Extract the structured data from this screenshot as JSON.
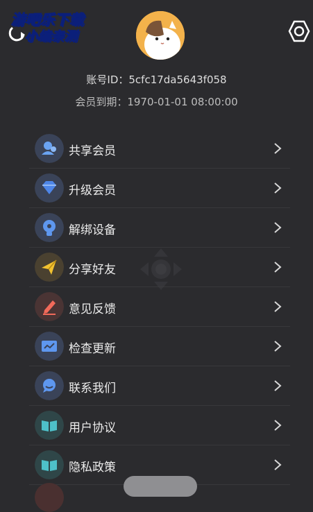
{
  "watermark": {
    "line1": "游吧乐下载",
    "line2": "小编亲测"
  },
  "profile": {
    "account_id": "账号ID：5cfc17da5643f058",
    "member_expiry": "会员到期：1970-01-01 08:00:00"
  },
  "menu": {
    "items": [
      {
        "label": "共享会员",
        "icon": "share-member-icon",
        "icon_bg": "#3a4358",
        "icon_color": "#6aa3f2"
      },
      {
        "label": "升级会员",
        "icon": "diamond-icon",
        "icon_bg": "#3a4358",
        "icon_color": "#4e86e8"
      },
      {
        "label": "解绑设备",
        "icon": "unbind-device-icon",
        "icon_bg": "#3a4358",
        "icon_color": "#5e97ef"
      },
      {
        "label": "分享好友",
        "icon": "paper-plane-icon",
        "icon_bg": "#4a4130",
        "icon_color": "#f2c230"
      },
      {
        "label": "意见反馈",
        "icon": "feedback-pen-icon",
        "icon_bg": "#4a3434",
        "icon_color": "#f26a5a"
      },
      {
        "label": "检查更新",
        "icon": "update-ticket-icon",
        "icon_bg": "#3a4358",
        "icon_color": "#5e97ef"
      },
      {
        "label": "联系我们",
        "icon": "contact-chat-icon",
        "icon_bg": "#3a4358",
        "icon_color": "#5e97ef"
      },
      {
        "label": "用户协议",
        "icon": "book-icon",
        "icon_bg": "#2f4648",
        "icon_color": "#4ec0c9"
      },
      {
        "label": "隐私政策",
        "icon": "book-icon",
        "icon_bg": "#2f4648",
        "icon_color": "#4ec0c9"
      }
    ]
  }
}
